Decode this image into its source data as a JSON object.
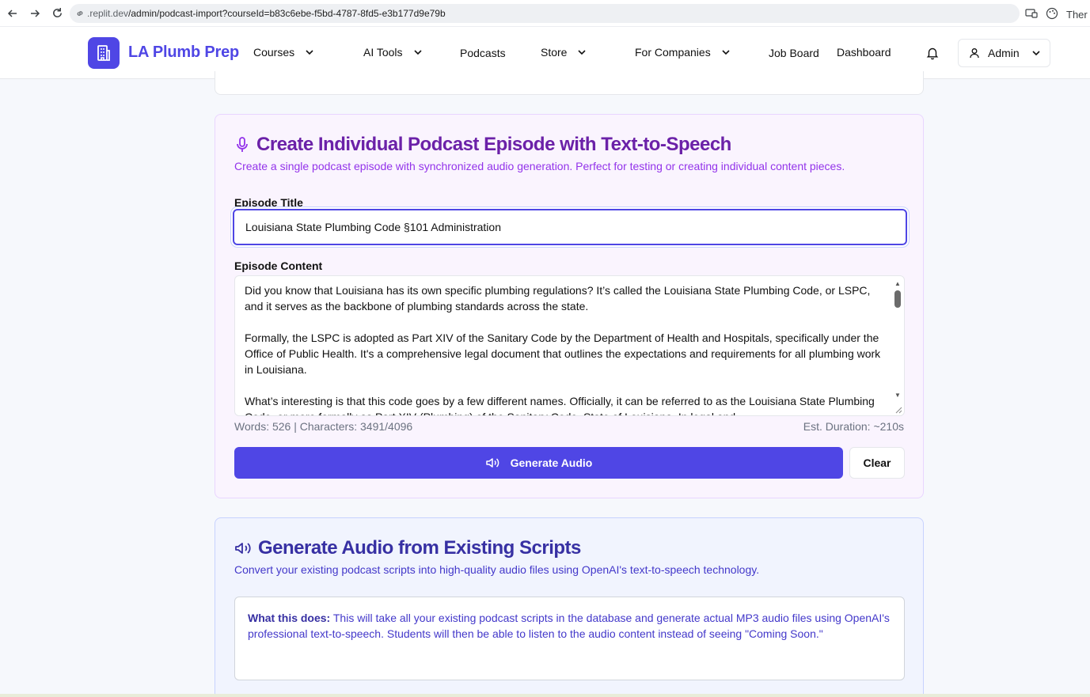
{
  "browser": {
    "url_domain": ".replit.dev",
    "url_path": "/admin/podcast-import?courseId=b83c6ebe-f5bd-4787-8fd5-e3b177d9e79b",
    "right_text": "Ther"
  },
  "header": {
    "logo_text": "LA Plumb Prep",
    "nav": {
      "courses": "Courses",
      "ai_tools": "AI Tools",
      "podcasts": "Podcasts",
      "store": "Store",
      "for_companies": "For Companies",
      "job_board": "Job Board",
      "dashboard": "Dashboard"
    },
    "admin_label": "Admin"
  },
  "create_card": {
    "title": "Create Individual Podcast Episode with Text-to-Speech",
    "description": "Create a single podcast episode with synchronized audio generation. Perfect for testing or creating individual content pieces.",
    "episode_title_label": "Episode Title",
    "episode_title_value": "Louisiana State Plumbing Code §101 Administration",
    "episode_content_label": "Episode Content",
    "episode_content_value": "Did you know that Louisiana has its own specific plumbing regulations? It’s called the Louisiana State Plumbing Code, or LSPC, and it serves as the backbone of plumbing standards across the state.\n\nFormally, the LSPC is adopted as Part XIV of the Sanitary Code by the Department of Health and Hospitals, specifically under the Office of Public Health. It's a comprehensive legal document that outlines the expectations and requirements for all plumbing work in Louisiana.\n\nWhat’s interesting is that this code goes by a few different names. Officially, it can be referred to as the Louisiana State Plumbing Code, or more formally as Part XIV (Plumbing) of the Sanitary Code, State of Louisiana. In legal and",
    "stats": "Words: 526 | Characters: 3491/4096",
    "duration": "Est. Duration: ~210s",
    "generate_label": "Generate Audio",
    "clear_label": "Clear"
  },
  "existing_card": {
    "title": "Generate Audio from Existing Scripts",
    "description": "Convert your existing podcast scripts into high-quality audio files using OpenAI's text-to-speech technology.",
    "info_bold": "What this does:",
    "info_text": " This will take all your existing podcast scripts in the database and generate actual MP3 audio files using OpenAI's professional text-to-speech. Students will then be able to listen to the audio content instead of seeing \"Coming Soon.\""
  },
  "colors": {
    "brand": "#4f46e5",
    "purple_title": "#6b21a8",
    "purple_text": "#9333ea",
    "blue_title": "#3730a3"
  }
}
